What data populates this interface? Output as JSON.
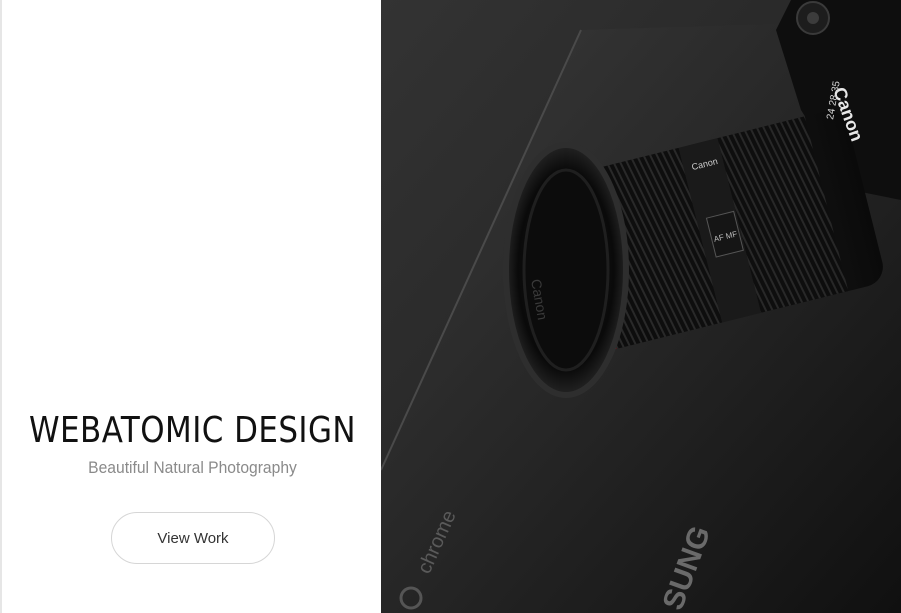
{
  "brand": {
    "title": "WEBATOMIC DESIGN",
    "subtitle": "Beautiful Natural Photography"
  },
  "cta": {
    "label": "View Work"
  },
  "hero": {
    "photo_text": {
      "lens_brand": "Canon",
      "body_brand": "Canon",
      "laptop_os": "chrome",
      "laptop_brand": "SUNG",
      "lens_switch": "AF MF",
      "focal_marks": "24 28 35"
    }
  },
  "colors": {
    "background": "#ffffff",
    "title": "#111111",
    "subtitle": "#8a8a8a",
    "button_border": "#d6d6d6",
    "lens_accent": "#c1121f"
  }
}
